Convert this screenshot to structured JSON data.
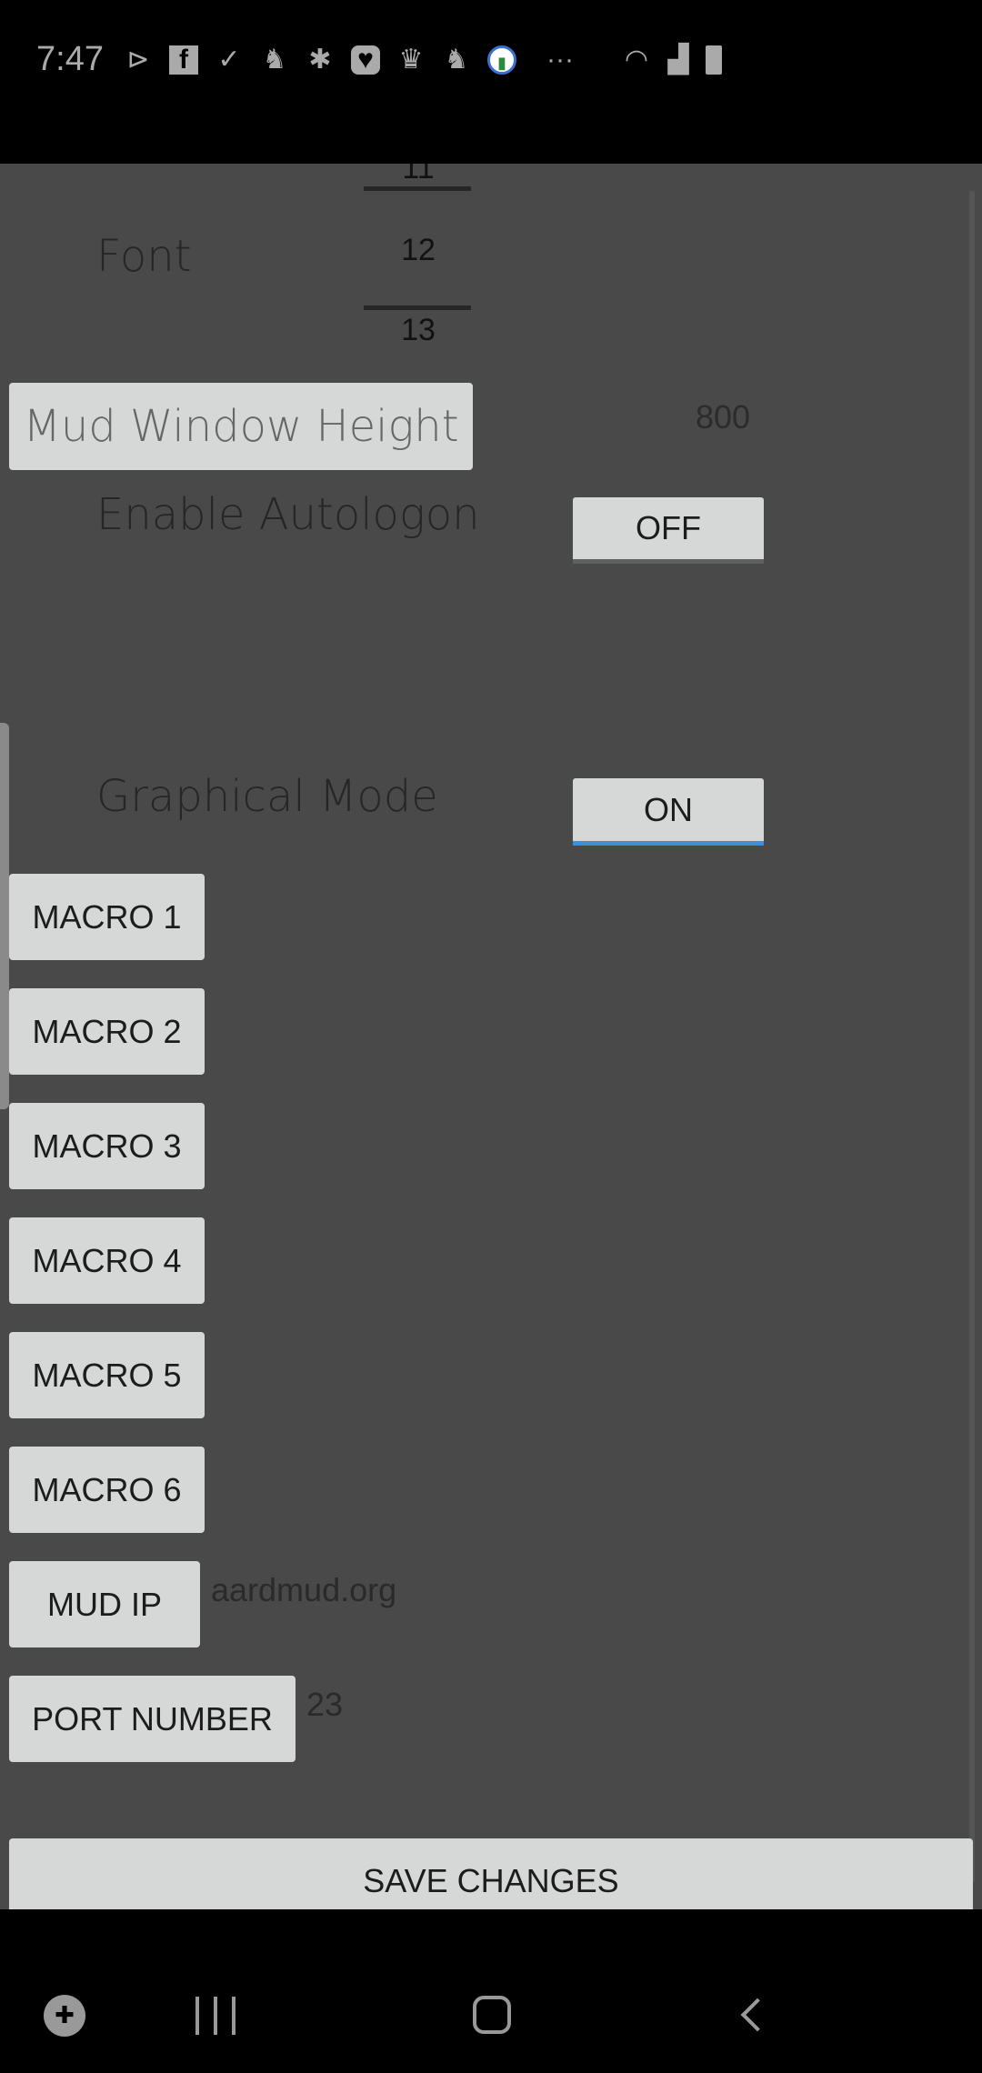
{
  "status_bar": {
    "time": "7:47",
    "icons": [
      "play-store-icon",
      "facebook-icon",
      "check-sync-icon",
      "app-icon",
      "yelp-icon",
      "pocket-icon",
      "crown-icon",
      "app-icon",
      "analytics-icon",
      "more-dots-icon"
    ],
    "more": "···",
    "right_icons": [
      "wifi-icon",
      "signal-icon",
      "battery-icon"
    ]
  },
  "settings": {
    "font": {
      "label": "Font",
      "picker": {
        "prev": "11",
        "current": "12",
        "next": "13"
      }
    },
    "mud_window_height": {
      "label": "Mud Window Height",
      "value": "800"
    },
    "autologon": {
      "label": "Enable Autologon",
      "toggle": "OFF",
      "state": false
    },
    "graphical_mode": {
      "label": "Graphical Mode",
      "toggle": "ON",
      "state": true
    },
    "macros": [
      "MACRO 1",
      "MACRO 2",
      "MACRO 3",
      "MACRO 4",
      "MACRO 5",
      "MACRO 6"
    ],
    "mud_ip": {
      "label": "MUD IP",
      "value": "aardmud.org"
    },
    "port": {
      "label": "PORT NUMBER",
      "value": "23"
    },
    "save_label": "SAVE CHANGES"
  },
  "colors": {
    "background": "#4a494a",
    "button": "#d6d8d7",
    "toggle_on_accent": "#3d8fd6"
  },
  "nav_bar": {
    "icons": [
      "game-launcher-icon",
      "recents-icon",
      "home-icon",
      "back-icon"
    ]
  }
}
